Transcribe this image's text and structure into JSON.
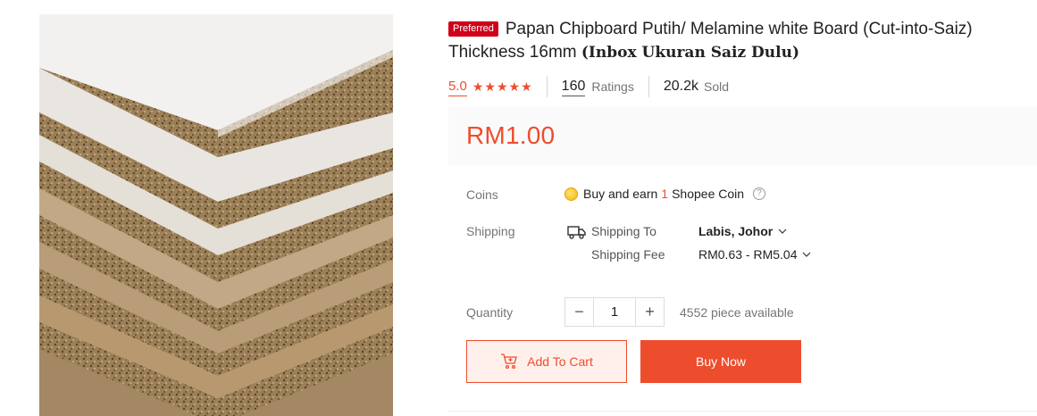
{
  "product": {
    "badge": "Preferred",
    "title_main": "Papan Chipboard Putih/ Melamine white Board (Cut-into-Saiz) Thickness 16mm ",
    "title_serif": "(Inbox Ukuran Saiz Dulu)",
    "image_icon": "chipboard-stack-photo"
  },
  "stats": {
    "rating": "5.0",
    "star_count": 5,
    "ratings_count": "160",
    "ratings_label": "Ratings",
    "sold_count": "20.2k",
    "sold_label": "Sold"
  },
  "price": "RM1.00",
  "coins": {
    "label": "Coins",
    "text_before": "Buy and earn",
    "amount": "1",
    "text_after": "Shopee Coin",
    "help": "?"
  },
  "shipping": {
    "label": "Shipping",
    "to_label": "Shipping To",
    "to_value": "Labis, Johor",
    "fee_label": "Shipping Fee",
    "fee_value": "RM0.63 - RM5.04"
  },
  "quantity": {
    "label": "Quantity",
    "minus": "−",
    "value": "1",
    "plus": "+",
    "available": "4552 piece available"
  },
  "actions": {
    "add_to_cart": "Add To Cart",
    "buy_now": "Buy Now"
  },
  "colors": {
    "accent": "#ee4d2d",
    "badge": "#d0011b"
  }
}
